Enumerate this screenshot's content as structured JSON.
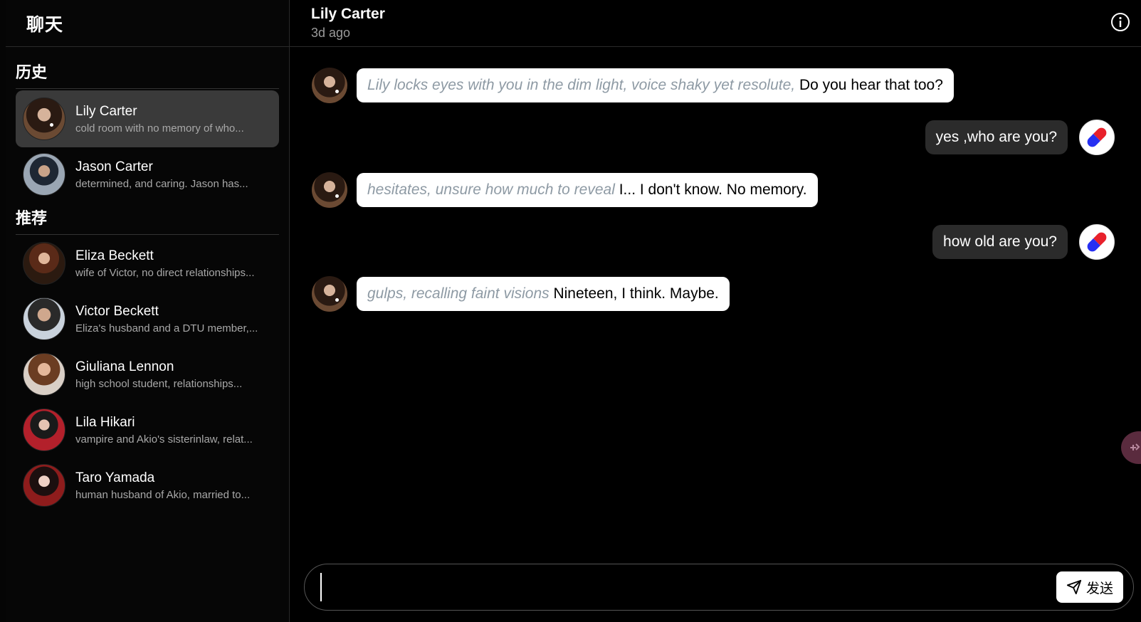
{
  "sidebar": {
    "title": "聊天",
    "history_label": "历史",
    "recommend_label": "推荐",
    "history": [
      {
        "name": "Lily Carter",
        "desc": "cold room with no memory of who..."
      },
      {
        "name": "Jason Carter",
        "desc": "determined, and caring. Jason has..."
      }
    ],
    "recommended": [
      {
        "name": "Eliza Beckett",
        "desc": "wife of Victor, no direct relationships..."
      },
      {
        "name": "Victor Beckett",
        "desc": "Eliza's husband and a DTU member,..."
      },
      {
        "name": "Giuliana Lennon",
        "desc": "high school student, relationships..."
      },
      {
        "name": "Lila Hikari",
        "desc": "vampire and Akio's sisterinlaw, relat..."
      },
      {
        "name": "Taro Yamada",
        "desc": "human husband of Akio, married to..."
      }
    ]
  },
  "header": {
    "name": "Lily Carter",
    "time": "3d ago",
    "info_icon": "info-icon"
  },
  "messages": [
    {
      "sender": "bot",
      "action": "Lily locks eyes with you in the dim light, voice shaky yet resolute,",
      "text": " Do you hear that too?"
    },
    {
      "sender": "user",
      "text": "yes ,who are you?"
    },
    {
      "sender": "bot",
      "action": "hesitates, unsure how much to reveal",
      "text": " I... I don't know. No memory."
    },
    {
      "sender": "user",
      "text": "how old are you?"
    },
    {
      "sender": "bot",
      "action": "gulps, recalling faint visions",
      "text": " Nineteen, I think. Maybe."
    }
  ],
  "composer": {
    "placeholder": "",
    "send_label": "发送"
  },
  "colors": {
    "accent": "#ffffff",
    "background": "#000000",
    "action_text": "#8e9aa4",
    "pill_red": "#e8212b",
    "pill_blue": "#2630f2"
  }
}
